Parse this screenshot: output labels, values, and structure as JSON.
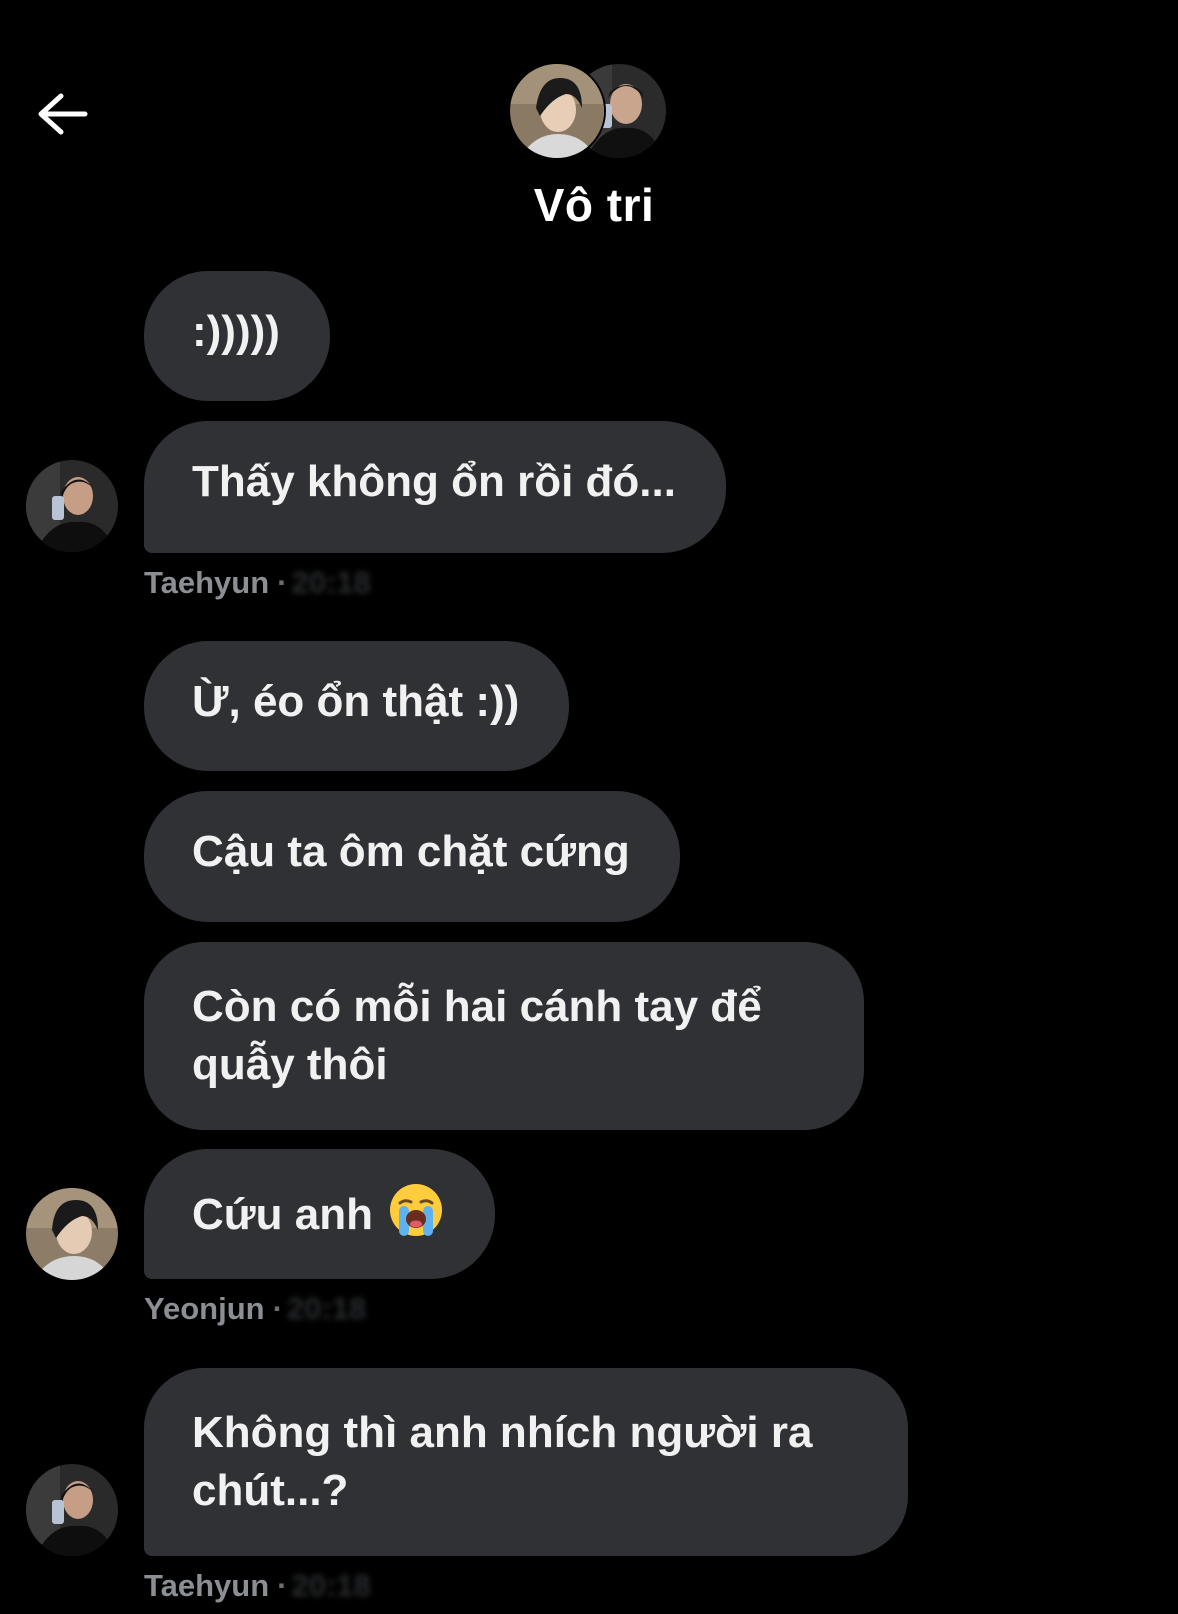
{
  "header": {
    "back_icon": "arrow-left-icon",
    "title": "Vô tri"
  },
  "colors": {
    "background": "#000000",
    "bubble": "#303134",
    "text": "#f1f1f1",
    "meta": "#8b8f93"
  },
  "messages": [
    {
      "text": ":)))))"
    },
    {
      "text": "Thấy không ổn rồi đó...",
      "sender": "Taehyun"
    },
    {
      "text": "Ừ, éo ổn thật :))"
    },
    {
      "text": "Cậu ta ôm chặt cứng"
    },
    {
      "text": "Còn có mỗi hai cánh tay để quẫy thôi"
    },
    {
      "text": "Cứu anh",
      "emoji": "loudly-crying-face-icon",
      "sender": "Yeonjun"
    },
    {
      "text": "Không thì anh nhích người ra chút...?",
      "sender": "Taehyun"
    }
  ]
}
